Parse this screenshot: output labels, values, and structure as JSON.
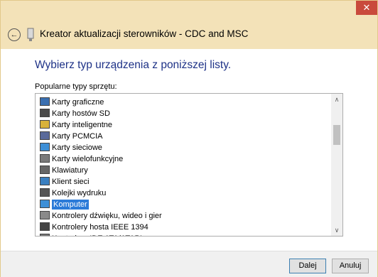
{
  "window": {
    "close_glyph": "✕"
  },
  "header": {
    "back_glyph": "←",
    "title": "Kreator aktualizacji sterowników - CDC and MSC",
    "icon": "device-icon"
  },
  "content": {
    "instruction": "Wybierz typ urządzenia z poniższej listy.",
    "list_label": "Popularne typy sprzętu:",
    "items": [
      {
        "label": "Karty graficzne",
        "icon": "display-adapter-icon"
      },
      {
        "label": "Karty hostów SD",
        "icon": "sd-host-icon"
      },
      {
        "label": "Karty inteligentne",
        "icon": "smart-card-icon"
      },
      {
        "label": "Karty PCMCIA",
        "icon": "pcmcia-icon"
      },
      {
        "label": "Karty sieciowe",
        "icon": "network-adapter-icon"
      },
      {
        "label": "Karty wielofunkcyjne",
        "icon": "multifunction-icon"
      },
      {
        "label": "Klawiatury",
        "icon": "keyboard-icon"
      },
      {
        "label": "Klient sieci",
        "icon": "network-client-icon"
      },
      {
        "label": "Kolejki wydruku",
        "icon": "printer-icon"
      },
      {
        "label": "Komputer",
        "icon": "computer-icon",
        "selected": true
      },
      {
        "label": "Kontrolery dźwięku, wideo i gier",
        "icon": "sound-icon"
      },
      {
        "label": "Kontrolery hosta IEEE 1394",
        "icon": "ieee1394-icon"
      },
      {
        "label": "Kontrolery IDE ATA/ATAPI",
        "icon": "ide-icon"
      }
    ],
    "scroll_up_glyph": "∧",
    "scroll_down_glyph": "∨"
  },
  "footer": {
    "next_label": "Dalej",
    "cancel_label": "Anuluj"
  }
}
